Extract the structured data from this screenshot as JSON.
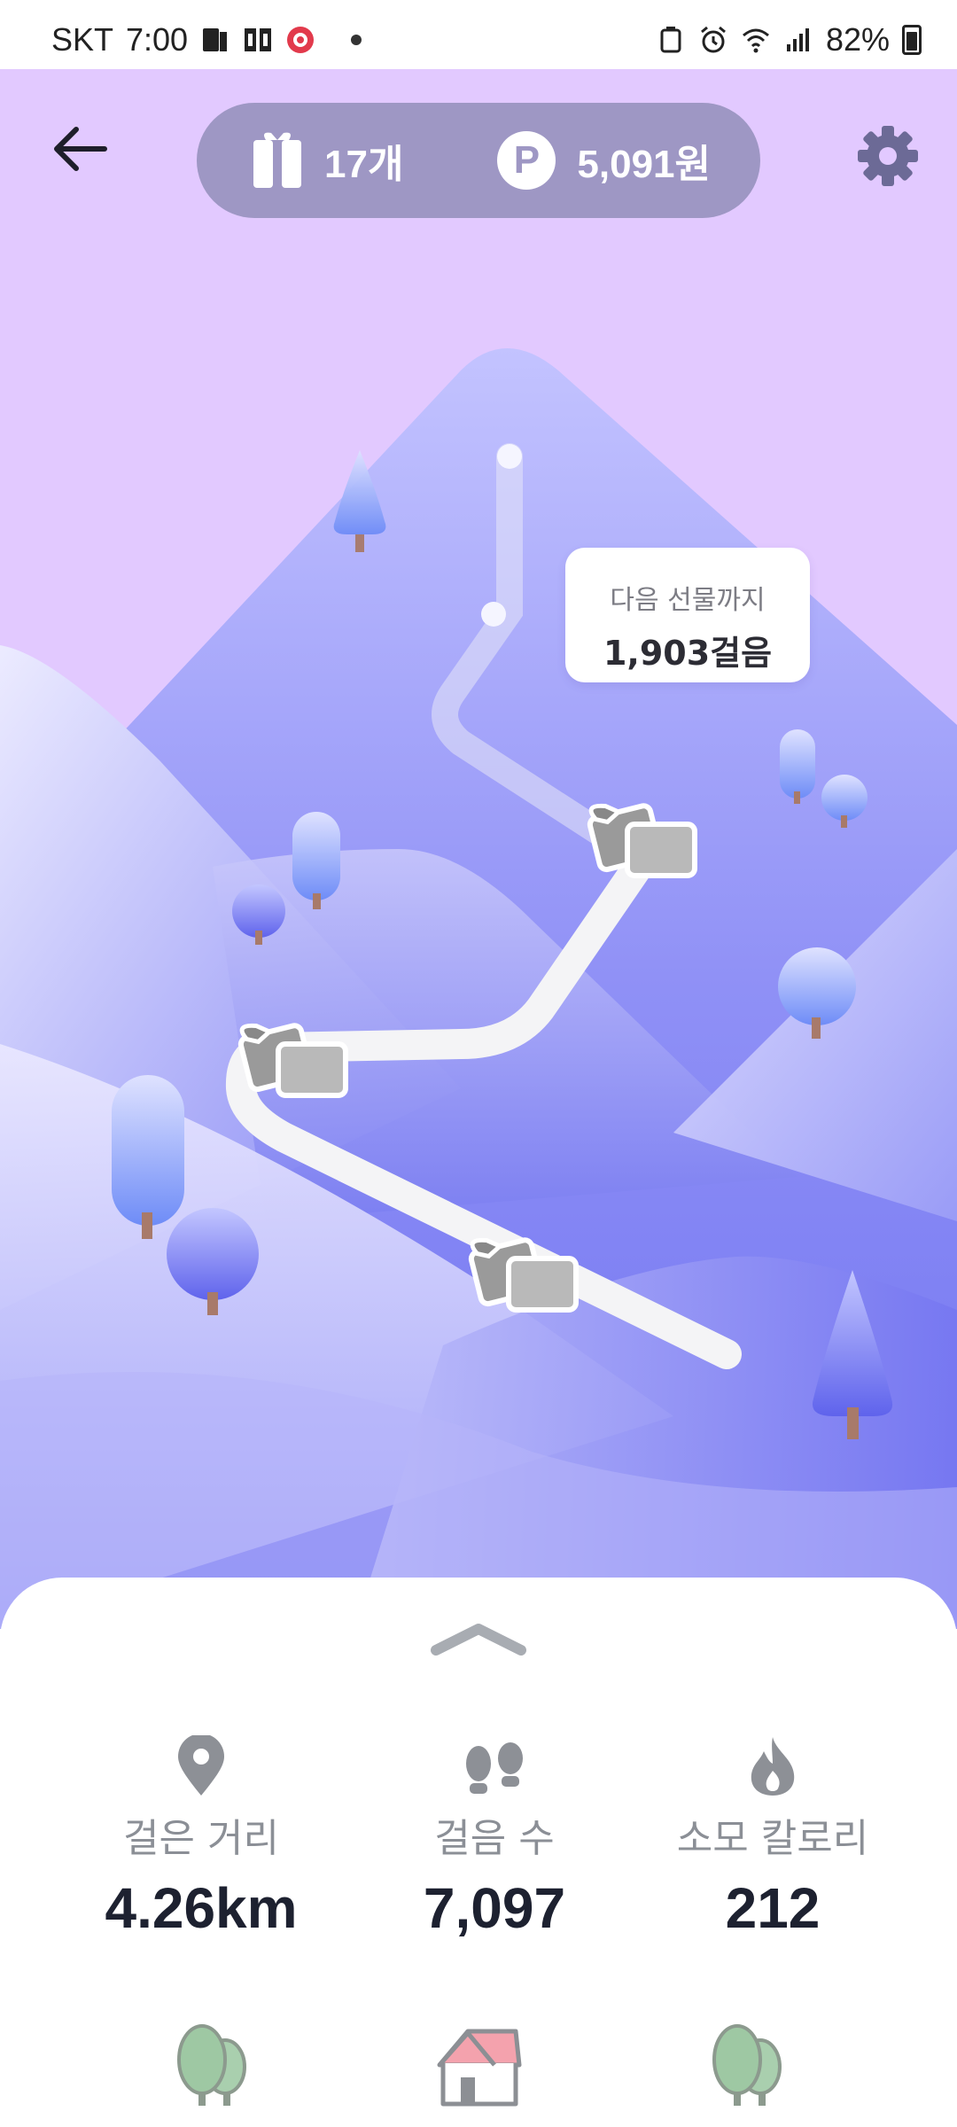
{
  "status_bar": {
    "carrier": "SKT",
    "time": "7:00",
    "battery": "82%"
  },
  "header": {
    "gift_count": "17개",
    "point_symbol": "P",
    "points": "5,091원"
  },
  "tooltip": {
    "title": "다음 선물까지",
    "value": "1,903걸음"
  },
  "stats": {
    "distance_label": "걸은 거리",
    "distance_value": "4.26km",
    "steps_label": "걸음 수",
    "steps_value": "7,097",
    "calories_label": "소모 칼로리",
    "calories_value": "212"
  },
  "colors": {
    "sky": "#e2c9ff",
    "pill": "#9e97c4",
    "mountain": "#8d8ef5",
    "stat_label": "#8b8f96",
    "stat_value": "#1d2130"
  },
  "icons": {
    "back": "arrow-left-icon",
    "gift": "gift-icon",
    "point": "point-icon",
    "settings": "gear-icon",
    "location": "location-pin-icon",
    "steps": "footprints-icon",
    "calories": "flame-icon",
    "nav_forest": "tree-icon",
    "nav_home": "house-icon"
  }
}
